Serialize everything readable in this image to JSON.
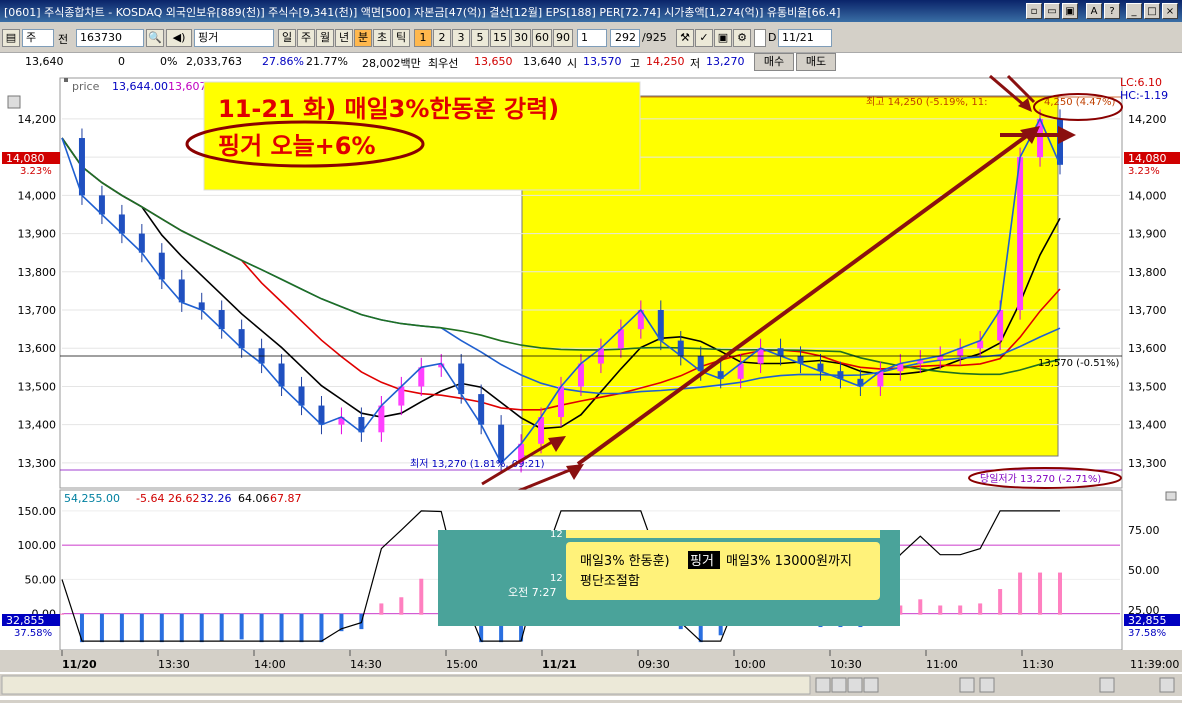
{
  "window": {
    "title": "[0601] 주식종합차트 - KOSDAQ 외국인보유[889(천)] 주식수[9,341(천)] 액면[500] 자본금[47(억)] 결산[12월] EPS[188] PER[72.74] 시가총액[1,274(억)] 유통비율[66.4]",
    "buttons": [
      "▫",
      "▭",
      "▣",
      "A",
      "?",
      "_",
      "□",
      "×"
    ]
  },
  "toolbar": {
    "type_select": "주",
    "prefix": "전",
    "code": "163730",
    "name": "핑거",
    "periods": [
      "일",
      "주",
      "월",
      "년",
      "분",
      "초",
      "틱"
    ],
    "minutes": [
      "1",
      "2",
      "3",
      "5",
      "15",
      "30",
      "60",
      "90"
    ],
    "interval_value": "1",
    "count": "292",
    "count_total": "/925",
    "date": "11/21",
    "d_label": "D"
  },
  "infobar": {
    "price": "13,640",
    "change": "0",
    "rate": "0%",
    "volume": "2,033,763",
    "vol_rate": "27.86%",
    "turnover": "21.77%",
    "amount": "28,002백만",
    "best_label": "최우선",
    "ask": "13,650",
    "bid": "13,640",
    "open_label": "시",
    "open": "13,570",
    "high_label": "고",
    "high": "14,250",
    "low_label": "저",
    "low": "13,270",
    "buy": "매수",
    "sell": "매도"
  },
  "price_panel": {
    "legend_label": "price",
    "legend_v1": "13,644.00",
    "legend_v2": "13,607,",
    "lc": "LC:6.10",
    "hc": "HC:-1.19",
    "current_tag": "14,080",
    "current_pct": "3.23%",
    "high_note": "최고 14,250 (-5.19%, 11:",
    "high_note2": "4,250 (4.47%)",
    "low_note": "최저 13,270 (1.81%, 09:21)",
    "avg_note": "13,570 (-0.51%)",
    "day_low_note": "당일저가 13,270 (-2.71%)"
  },
  "annotation": {
    "headline": "11-21 화) 매일3%한동훈 강력)",
    "sub": "핑거 오늘+6%"
  },
  "indicator_panel": {
    "legend_v1": "54,255.00",
    "legend_v2": "-5.64",
    "legend_v3": "26.62",
    "legend_v4": "32.26",
    "legend_v5": "64.06",
    "legend_v6": "67.87",
    "left_tag": "32,855",
    "left_pct": "37.58%",
    "right_tag": "32,855",
    "right_pct": "37.58%"
  },
  "popup": {
    "count_top": "12",
    "message_pre": "매일3% 한동훈)",
    "message_highlight": "핑거",
    "message_post": "매일3% 13000원까지",
    "message_line2": "평단조절함",
    "count_bottom": "12",
    "time": "오전 7:27"
  },
  "time_axis": {
    "labels": [
      "11/20",
      "13:30",
      "14:00",
      "14:30",
      "15:00",
      "11/21",
      "09:30",
      "10:00",
      "10:30",
      "11:00",
      "11:30",
      "11:39:00"
    ]
  },
  "chart_data": [
    {
      "type": "line",
      "title": "",
      "y_ticks_price": [
        14200,
        14100,
        14000,
        13900,
        13800,
        13700,
        13600,
        13500,
        13400,
        13300
      ],
      "ylim": [
        13250,
        14260
      ],
      "key_levels": {
        "high": 14250,
        "low": 13270,
        "current": 14080,
        "avg": 13570,
        "day_open": 13570
      },
      "series": [
        {
          "name": "price",
          "values": [
            14150,
            14000,
            13950,
            13900,
            13850,
            13780,
            13720,
            13700,
            13650,
            13600,
            13560,
            13500,
            13450,
            13400,
            13420,
            13380,
            13450,
            13500,
            13550,
            13560,
            13480,
            13400,
            13300,
            13350,
            13420,
            13500,
            13560,
            13600,
            13650,
            13700,
            13620,
            13580,
            13540,
            13520,
            13560,
            13600,
            13580,
            13560,
            13540,
            13520,
            13500,
            13540,
            13560,
            13570,
            13580,
            13600,
            13620,
            13700,
            14100,
            14200,
            14080
          ]
        }
      ]
    },
    {
      "type": "line",
      "title": "",
      "y_ticks": [
        150,
        100,
        50,
        0
      ],
      "ylim": [
        -50,
        160
      ],
      "right_ticks": [
        75,
        50,
        25
      ]
    }
  ]
}
